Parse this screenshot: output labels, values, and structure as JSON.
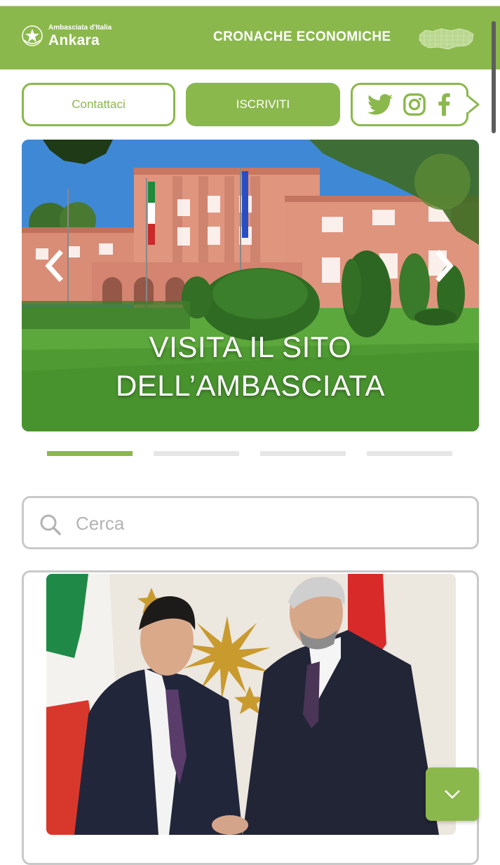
{
  "header": {
    "logo_small": "Ambasciata d'Italia",
    "logo_big": "Ankara",
    "title": "CRONACHE ECONOMICHE",
    "background_color": "#8bb84c"
  },
  "actions": {
    "contact_label": "Contattaci",
    "subscribe_label": "ISCRIVITI",
    "social_icons": [
      "twitter-icon",
      "instagram-icon",
      "facebook-icon"
    ]
  },
  "slider": {
    "caption_line1": "VISITA IL SITO",
    "caption_line2": "DELL’AMBASCIATA",
    "slide_count": 4,
    "active_slide": 1
  },
  "search": {
    "placeholder": "Cerca"
  },
  "colors": {
    "accent": "#8bb84c",
    "border": "#c9c9c9",
    "indicator_inactive": "#e6e6e6"
  }
}
